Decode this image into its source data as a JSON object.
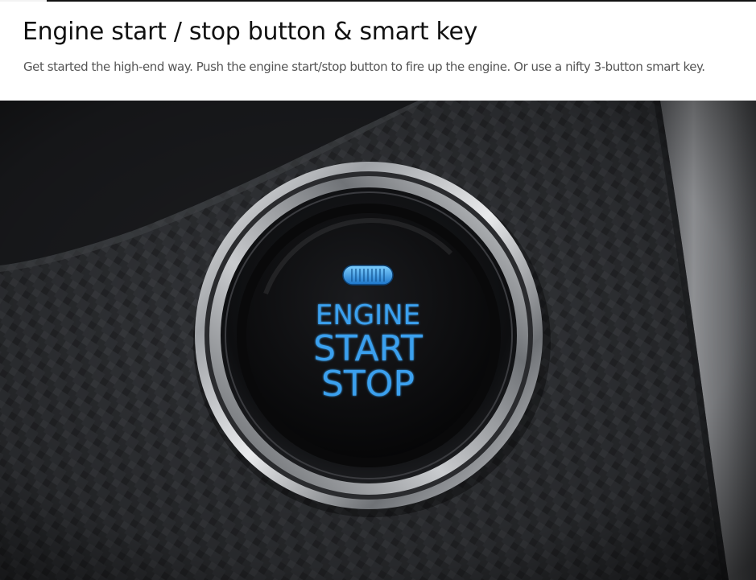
{
  "header": {
    "title": "Engine start / stop button & smart key",
    "description": "Get started the high-end way. Push the engine start/stop button to fire up the engine. Or use a nifty 3-button smart key."
  },
  "photo": {
    "button_label": {
      "line1": "ENGINE",
      "line2": "START",
      "line3": "STOP"
    },
    "colors": {
      "label_glow": "#3aa0ee",
      "dash_surface": "#2b2c2f",
      "chrome": "#d8dadd",
      "trim_panel": "#9c9ea2"
    }
  }
}
